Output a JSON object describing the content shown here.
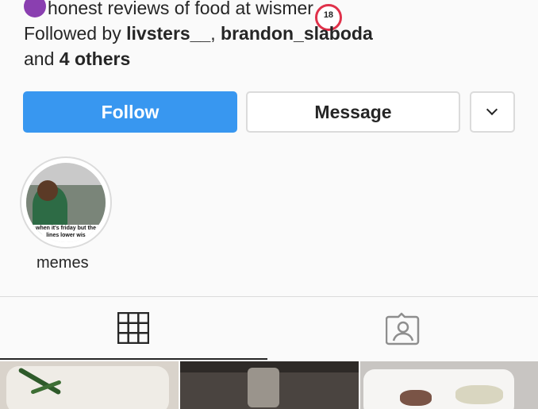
{
  "profile": {
    "bio_text": "honest reviews of food at wismer",
    "bio_badge": "18",
    "followed_prefix": "Followed by",
    "follower_1": "livsters__",
    "follower_2": "brandon_slaboda",
    "others_prefix": "and",
    "others_count": "4 others"
  },
  "actions": {
    "follow_label": "Follow",
    "message_label": "Message",
    "more_icon": "chevron-down-icon"
  },
  "highlights": [
    {
      "label": "memes",
      "caption": "when it's friday but the lines lower wis"
    }
  ],
  "tabs": {
    "grid_icon": "grid-icon",
    "tagged_icon": "tagged-person-icon"
  },
  "colors": {
    "accent": "#3897f0",
    "border": "#dbdbdb",
    "text": "#262626",
    "background": "#fafafa"
  }
}
